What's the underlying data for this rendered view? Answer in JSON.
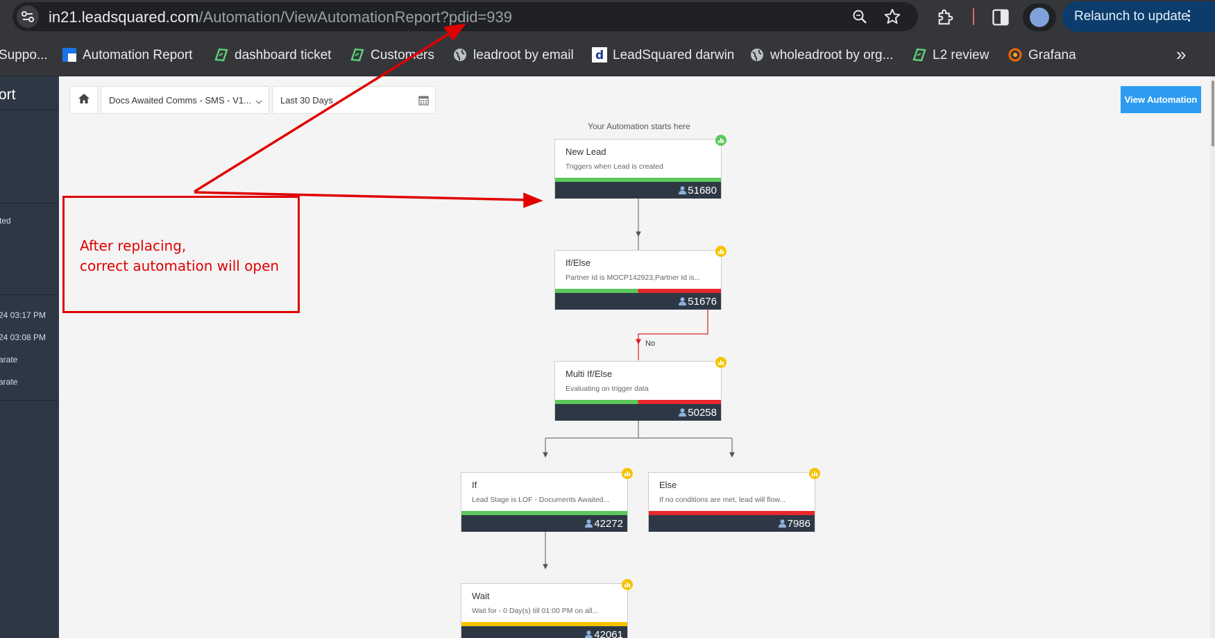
{
  "browser": {
    "url_host": "in21.leadsquared.com",
    "url_path": "/Automation/ViewAutomationReport?pdid=939",
    "relaunch_label": "Relaunch to update",
    "bookmarks": [
      {
        "label": "Suppo...",
        "icon": "partial-bookmark-icon"
      },
      {
        "label": "Automation Report",
        "icon": "leadsquared-icon"
      },
      {
        "label": "dashboard ticket",
        "icon": "green-ticket-icon"
      },
      {
        "label": "Customers",
        "icon": "green-ticket-icon"
      },
      {
        "label": "leadroot by email",
        "icon": "globe-icon"
      },
      {
        "label": "LeadSquared darwin",
        "icon": "d-icon"
      },
      {
        "label": "wholeadroot by org...",
        "icon": "globe-icon"
      },
      {
        "label": "L2 review",
        "icon": "green-ticket-icon"
      },
      {
        "label": "Grafana",
        "icon": "grafana-icon"
      }
    ]
  },
  "sidebar": {
    "title": "ort",
    "lines": [
      "ted",
      "24 03:17 PM",
      "24 03:08 PM",
      "arate",
      "arate"
    ]
  },
  "toolbar": {
    "automation_select": "Docs Awaited Comms - SMS - V1...",
    "date_range": "Last 30 Days",
    "view_automation_label": "View Automation"
  },
  "flow": {
    "start_label": "Your Automation starts here",
    "branch_label": "No",
    "nodes": [
      {
        "title": "New Lead",
        "desc": "Triggers when Lead is created",
        "count": "51680",
        "badge": "green"
      },
      {
        "title": "If/Else",
        "desc": "Partner Id is MOCP142923,Partner Id is...",
        "count": "51676",
        "badge": "yellow"
      },
      {
        "title": "Multi If/Else",
        "desc": "Evaluating on trigger data",
        "count": "50258",
        "badge": "yellow"
      },
      {
        "title": "If",
        "desc": "Lead Stage is LOF - Documents Awaited...",
        "count": "42272",
        "badge": "yellow"
      },
      {
        "title": "Else",
        "desc": "If no conditions are met, lead will flow...",
        "count": "7986",
        "badge": "yellow"
      },
      {
        "title": "Wait",
        "desc": "Wait for - 0 Day(s) till 01:00 PM on all...",
        "count": "42061",
        "badge": "yellow"
      }
    ]
  },
  "annotation": {
    "text": "After replacing,\ncorrect automation will open"
  },
  "colors": {
    "success": "#5cc85c",
    "failure": "#e8282b",
    "wait": "#f5c400",
    "node_footer": "#2e3845",
    "badge_green": "#5cc85c",
    "badge_yellow": "#f5c400",
    "annotation": "#e00000",
    "primary_button": "#2d9cf0"
  }
}
